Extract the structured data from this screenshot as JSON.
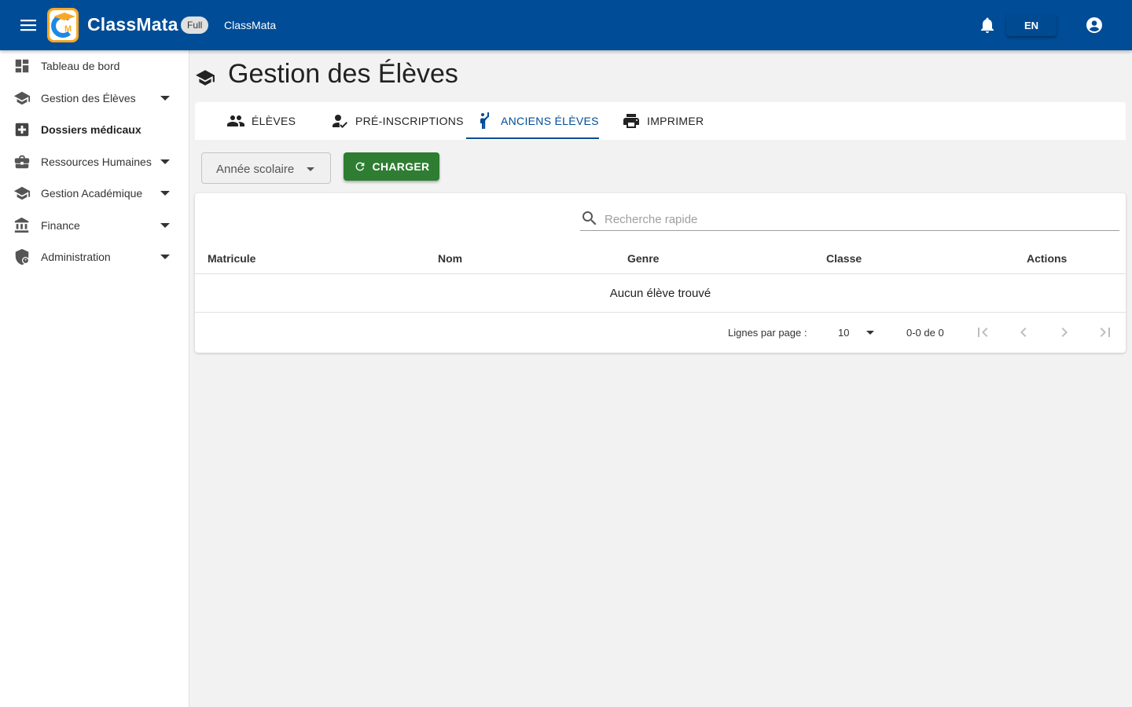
{
  "app": {
    "brand": "ClassMata",
    "plan_badge": "Full",
    "subtitle": "ClassMata",
    "language": "EN",
    "primary_color": "#004c97",
    "success_color": "#2e7d32"
  },
  "sidebar": {
    "items": [
      {
        "label": "Tableau de bord",
        "icon": "dashboard-icon",
        "expandable": false
      },
      {
        "label": "Gestion des Élèves",
        "icon": "school-icon",
        "expandable": true
      },
      {
        "label": "Dossiers médicaux",
        "icon": "medical-cross-icon",
        "expandable": false,
        "active": true
      },
      {
        "label": "Ressources Humaines",
        "icon": "briefcase-icon",
        "expandable": true
      },
      {
        "label": "Gestion Académique",
        "icon": "school-icon",
        "expandable": true
      },
      {
        "label": "Finance",
        "icon": "bank-icon",
        "expandable": true
      },
      {
        "label": "Administration",
        "icon": "admin-shield-icon",
        "expandable": true
      }
    ]
  },
  "page": {
    "title": "Gestion des Élèves",
    "icon": "school-icon"
  },
  "tabs": [
    {
      "label": "ÉLÈVES",
      "icon": "people-icon"
    },
    {
      "label": "PRÉ-INSCRIPTIONS",
      "icon": "person-check-icon"
    },
    {
      "label": "ANCIENS ÉLÈVES",
      "icon": "person-raised-hand-icon",
      "active": true
    },
    {
      "label": "IMPRIMER",
      "icon": "printer-icon"
    }
  ],
  "filters": {
    "year_label": "Année scolaire",
    "load_button": "CHARGER"
  },
  "table": {
    "search_placeholder": "Recherche rapide",
    "columns": [
      "Matricule",
      "Nom",
      "Genre",
      "Classe",
      "Actions"
    ],
    "empty_message": "Aucun élève trouvé",
    "rows": []
  },
  "pagination": {
    "rows_per_page_label": "Lignes par page :",
    "rows_per_page": "10",
    "range": "0-0 de 0"
  }
}
